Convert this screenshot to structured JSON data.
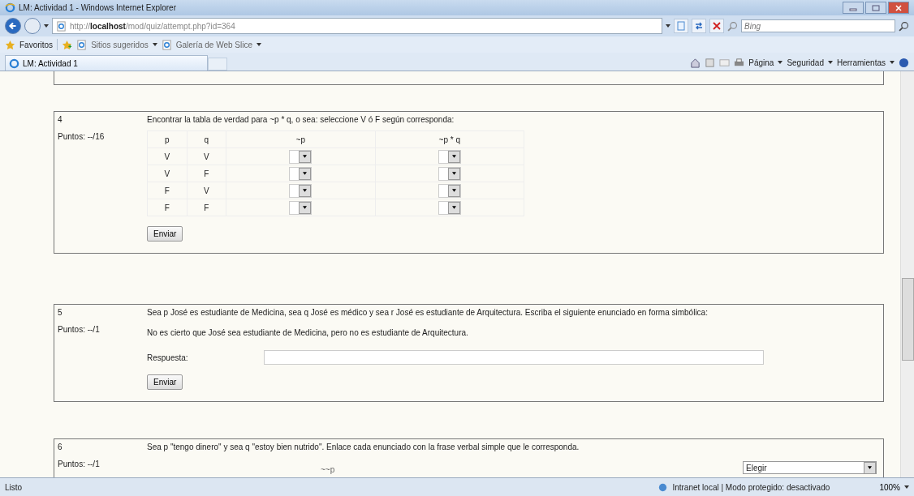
{
  "window": {
    "title": "LM: Actividad 1 - Windows Internet Explorer"
  },
  "address_bar": {
    "url_prefix": "http://",
    "url_host": "localhost",
    "url_path": "/mod/quiz/attempt.php?id=364"
  },
  "search": {
    "placeholder": "Bing"
  },
  "favorites_bar": {
    "label": "Favoritos",
    "links": [
      "Sitios sugeridos",
      "Galería de Web Slice"
    ]
  },
  "tabs": [
    {
      "label": "LM: Actividad 1",
      "selected": true
    }
  ],
  "command_bar": [
    "Página",
    "Seguridad",
    "Herramientas"
  ],
  "questions": [
    {
      "number": "4",
      "points": "Puntos: --/16",
      "kind": "truth_table",
      "prompt": "Encontrar la tabla de verdad para ~p * q, o sea: seleccione V ó F según corresponda:",
      "columns": [
        "p",
        "q",
        "~p",
        "~p * q"
      ],
      "rows": [
        [
          "V",
          "V"
        ],
        [
          "V",
          "F"
        ],
        [
          "F",
          "V"
        ],
        [
          "F",
          "F"
        ]
      ],
      "button": "Enviar"
    },
    {
      "number": "5",
      "points": "Puntos: --/1",
      "kind": "text_answer",
      "prompt": "Sea p José es estudiante de Medicina, sea q José es médico y sea r José es estudiante de Arquitectura. Escriba el siguiente enunciado en forma simbólica:",
      "statement": "No es cierto que José sea estudiante de Medicina, pero no es estudiante de Arquitectura.",
      "answer_label": "Respuesta:",
      "button": "Enviar"
    },
    {
      "number": "6",
      "points": "Puntos: --/1",
      "kind": "matching",
      "prompt": "Sea p \"tengo dinero\" y sea q \"estoy bien nutrido\". Enlace cada enunciado con la frase verbal simple que le corresponda.",
      "item": "~~p",
      "choice": "Elegir"
    }
  ],
  "status_bar": {
    "left": "Listo",
    "zone": "Intranet local | Modo protegido: desactivado",
    "zoom": "100%"
  }
}
